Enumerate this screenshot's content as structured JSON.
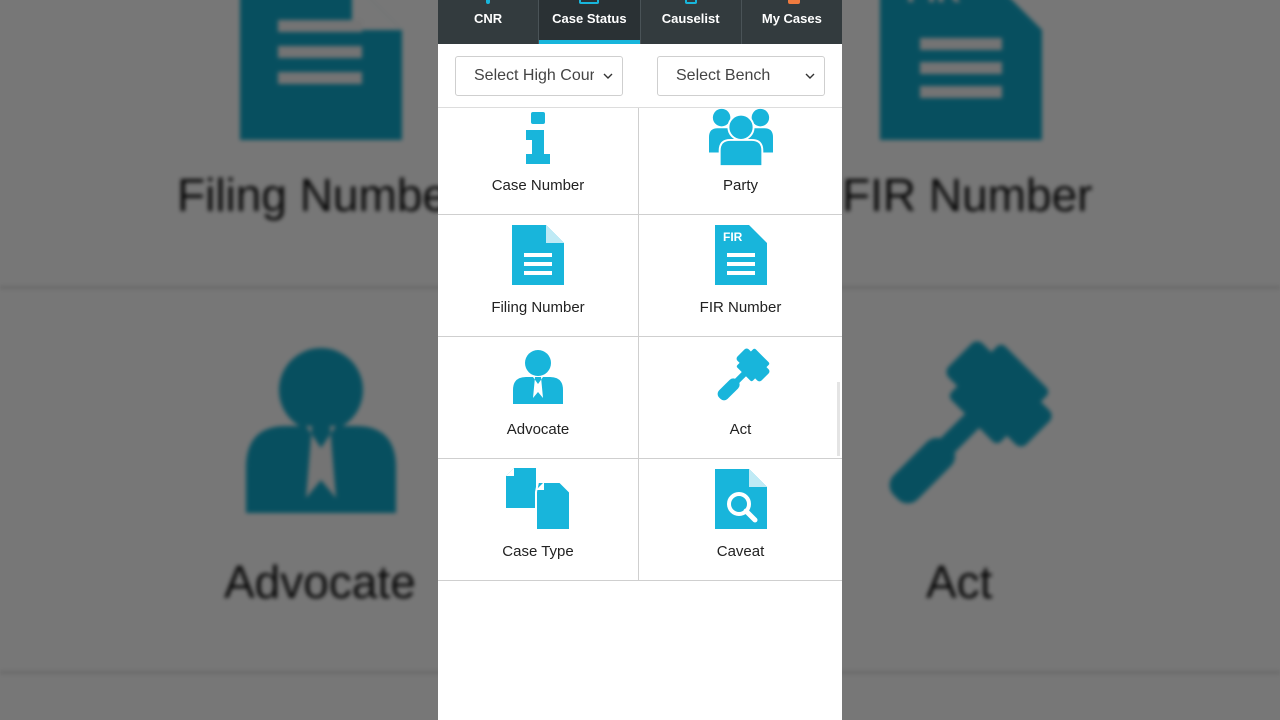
{
  "tabs": [
    {
      "label": "CNR",
      "active": false
    },
    {
      "label": "Case Status",
      "active": true
    },
    {
      "label": "Causelist",
      "active": false
    },
    {
      "label": "My Cases",
      "active": false
    }
  ],
  "filters": {
    "high_court": "Select High Court",
    "bench": "Select Bench"
  },
  "options": [
    {
      "label": "Case Number",
      "icon": "info-icon"
    },
    {
      "label": "Party",
      "icon": "group-icon"
    },
    {
      "label": "Filing Number",
      "icon": "document-icon"
    },
    {
      "label": "FIR Number",
      "icon": "fir-document-icon"
    },
    {
      "label": "Advocate",
      "icon": "advocate-icon"
    },
    {
      "label": "Act",
      "icon": "gavel-icon"
    },
    {
      "label": "Case Type",
      "icon": "copy-documents-icon"
    },
    {
      "label": "Caveat",
      "icon": "search-document-icon"
    }
  ],
  "background": {
    "labels": [
      "Filing Number",
      "FIR Number",
      "Advocate",
      "Act"
    ],
    "fir_text": "FIR"
  },
  "colors": {
    "accent": "#18b5db",
    "tabbar": "#333b3e",
    "my_cases_badge": "#f07b3f"
  }
}
